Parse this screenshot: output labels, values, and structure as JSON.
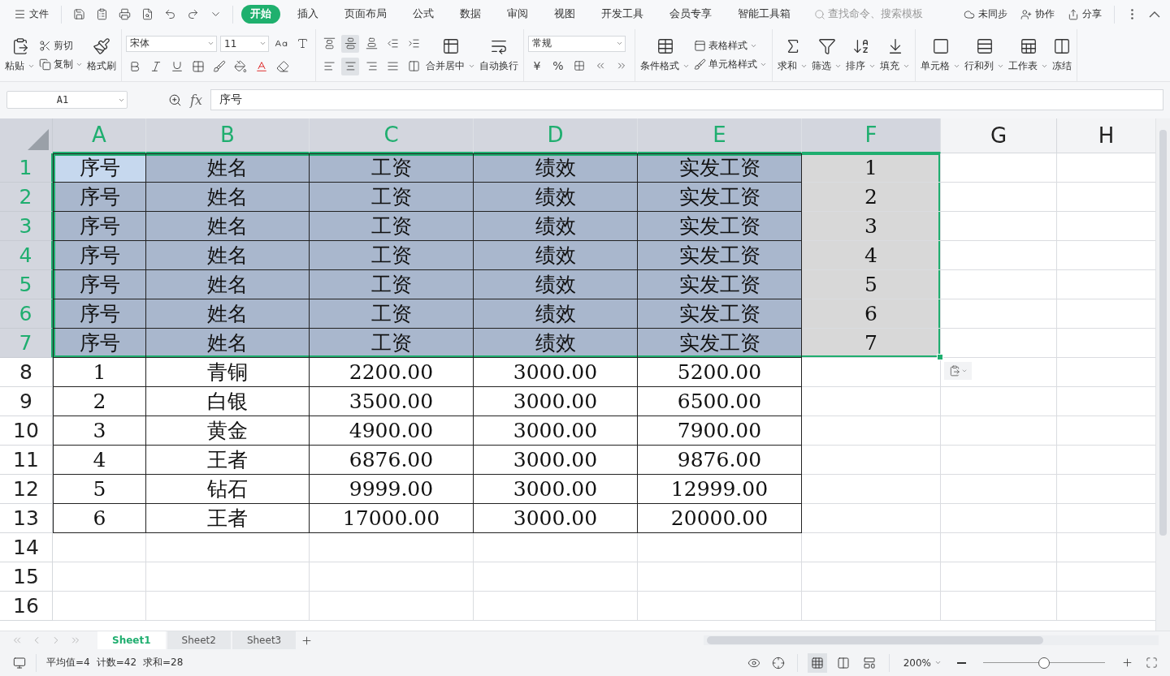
{
  "menu_bar": {
    "file_label": "文件",
    "tabs": [
      {
        "label": "开始",
        "selected": true
      },
      {
        "label": "插入",
        "selected": false
      },
      {
        "label": "页面布局",
        "selected": false
      },
      {
        "label": "公式",
        "selected": false
      },
      {
        "label": "数据",
        "selected": false
      },
      {
        "label": "审阅",
        "selected": false
      },
      {
        "label": "视图",
        "selected": false
      },
      {
        "label": "开发工具",
        "selected": false
      },
      {
        "label": "会员专享",
        "selected": false
      },
      {
        "label": "智能工具箱",
        "selected": false
      }
    ],
    "search": {
      "placeholder": "查找命令、搜索模板"
    },
    "actions": [
      "未同步",
      "协作",
      "分享"
    ]
  },
  "ribbon": {
    "paste": "粘贴",
    "cut": "剪切",
    "copy": "复制",
    "format_painter": "格式刷",
    "font": {
      "name": "宋体",
      "size": "11"
    },
    "align_buttons": [
      {
        "selected": false
      },
      {
        "selected": true
      },
      {
        "selected": false
      },
      {
        "selected": false
      },
      {
        "selected": false
      },
      {
        "selected": false
      },
      {
        "selected": true
      },
      {
        "selected": false
      },
      {
        "selected": false
      },
      {
        "selected": false
      }
    ],
    "merge": "合并居中",
    "wrap": "自动换行",
    "number_format": "常规",
    "currency": "¥",
    "percent": "%",
    "table_style": "表格样式",
    "conditional_format": "条件格式",
    "cell_style": "单元格样式",
    "tools": [
      "求和",
      "筛选",
      "排序",
      "填充"
    ],
    "cells_tools": [
      "单元格",
      "行和列",
      "工作表"
    ],
    "freeze": "冻结"
  },
  "formula_bar": {
    "name_box": "A1",
    "function_label": "fx",
    "formula": "序号"
  },
  "sheet": {
    "columns": [
      {
        "label": "A",
        "selected": true
      },
      {
        "label": "B",
        "selected": true
      },
      {
        "label": "C",
        "selected": true
      },
      {
        "label": "D",
        "selected": true
      },
      {
        "label": "E",
        "selected": true
      },
      {
        "label": "F",
        "selected": true
      },
      {
        "label": "G",
        "selected": false
      },
      {
        "label": "H",
        "selected": false
      }
    ],
    "rows": [
      {
        "header": "1",
        "kind": "filled",
        "selected": true,
        "active": true,
        "cells": [
          "序号",
          "姓名",
          "工资",
          "绩效",
          "实发工资"
        ],
        "f_value": "1"
      },
      {
        "header": "2",
        "kind": "filled",
        "selected": true,
        "active": false,
        "cells": [
          "序号",
          "姓名",
          "工资",
          "绩效",
          "实发工资"
        ],
        "f_value": "2"
      },
      {
        "header": "3",
        "kind": "filled",
        "selected": true,
        "active": false,
        "cells": [
          "序号",
          "姓名",
          "工资",
          "绩效",
          "实发工资"
        ],
        "f_value": "3"
      },
      {
        "header": "4",
        "kind": "filled",
        "selected": true,
        "active": false,
        "cells": [
          "序号",
          "姓名",
          "工资",
          "绩效",
          "实发工资"
        ],
        "f_value": "4"
      },
      {
        "header": "5",
        "kind": "filled",
        "selected": true,
        "active": false,
        "cells": [
          "序号",
          "姓名",
          "工资",
          "绩效",
          "实发工资"
        ],
        "f_value": "5"
      },
      {
        "header": "6",
        "kind": "filled",
        "selected": true,
        "active": false,
        "cells": [
          "序号",
          "姓名",
          "工资",
          "绩效",
          "实发工资"
        ],
        "f_value": "6"
      },
      {
        "header": "7",
        "kind": "filled",
        "selected": true,
        "active": false,
        "cells": [
          "序号",
          "姓名",
          "工资",
          "绩效",
          "实发工资"
        ],
        "f_value": "7"
      },
      {
        "header": "8",
        "kind": "data",
        "selected": false,
        "active": false,
        "cells": [
          "1",
          "青铜",
          "2200.00",
          "3000.00",
          "5200.00"
        ]
      },
      {
        "header": "9",
        "kind": "data",
        "selected": false,
        "active": false,
        "cells": [
          "2",
          "白银",
          "3500.00",
          "3000.00",
          "6500.00"
        ]
      },
      {
        "header": "10",
        "kind": "data",
        "selected": false,
        "active": false,
        "cells": [
          "3",
          "黄金",
          "4900.00",
          "3000.00",
          "7900.00"
        ]
      },
      {
        "header": "11",
        "kind": "data",
        "selected": false,
        "active": false,
        "cells": [
          "4",
          "王者",
          "6876.00",
          "3000.00",
          "9876.00"
        ]
      },
      {
        "header": "12",
        "kind": "data",
        "selected": false,
        "active": false,
        "cells": [
          "5",
          "钻石",
          "9999.00",
          "3000.00",
          "12999.00"
        ]
      },
      {
        "header": "13",
        "kind": "data",
        "selected": false,
        "active": false,
        "cells": [
          "6",
          "王者",
          "17000.00",
          "3000.00",
          "20000.00"
        ]
      },
      {
        "header": "14",
        "kind": "empty",
        "selected": false,
        "active": false
      },
      {
        "header": "15",
        "kind": "empty",
        "selected": false,
        "active": false
      },
      {
        "header": "16",
        "kind": "empty",
        "selected": false,
        "active": false
      }
    ]
  },
  "sheet_tabs": [
    {
      "label": "Sheet1",
      "selected": true
    },
    {
      "label": "Sheet2",
      "selected": false
    },
    {
      "label": "Sheet3",
      "selected": false
    }
  ],
  "status_bar": {
    "stats": [
      "平均值=4",
      "计数=42",
      "求和=28"
    ],
    "view_modes": [
      {
        "selected": true
      },
      {
        "selected": false
      },
      {
        "selected": false
      }
    ],
    "zoom": "200%",
    "zoom_slider": {
      "level": 0.5
    }
  }
}
